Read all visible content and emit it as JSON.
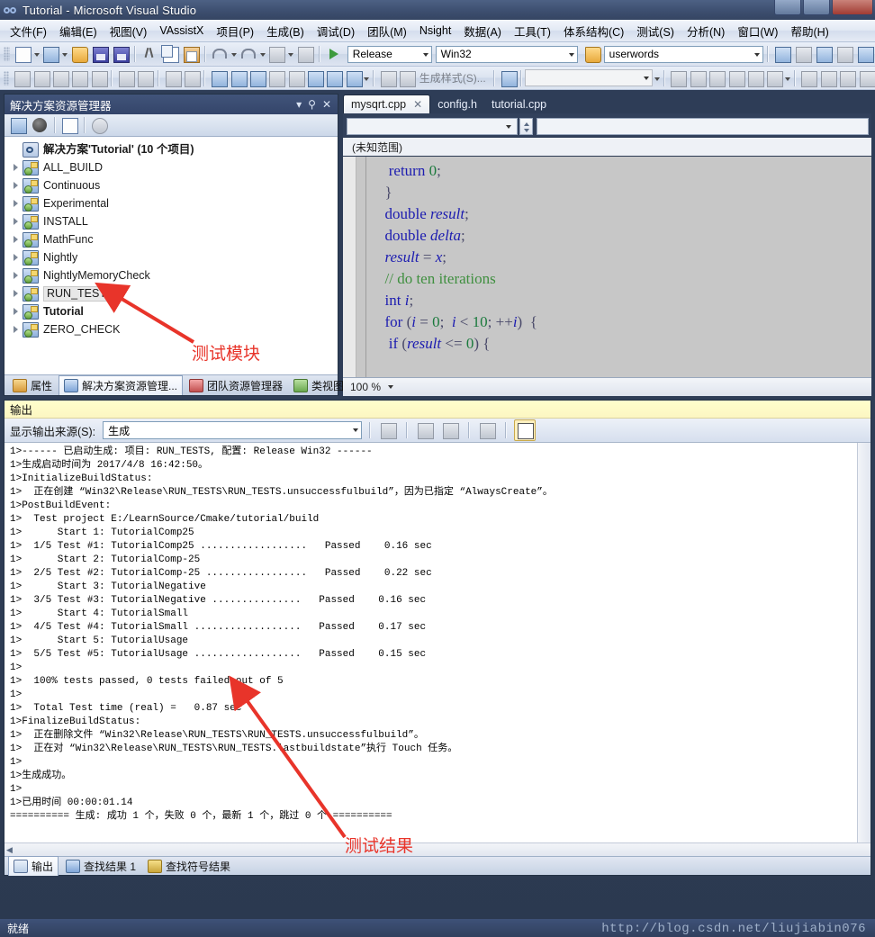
{
  "window": {
    "title": "Tutorial - Microsoft Visual Studio",
    "logo_icon": "visual-studio-logo-icon",
    "minimize_label": "",
    "maximize_label": "",
    "close_label": ""
  },
  "menubar": {
    "items": [
      {
        "label": "文件(F)"
      },
      {
        "label": "编辑(E)"
      },
      {
        "label": "视图(V)"
      },
      {
        "label": "VAssistX"
      },
      {
        "label": "项目(P)"
      },
      {
        "label": "生成(B)"
      },
      {
        "label": "调试(D)"
      },
      {
        "label": "团队(M)"
      },
      {
        "label": "Nsight"
      },
      {
        "label": "数据(A)"
      },
      {
        "label": "工具(T)"
      },
      {
        "label": "体系结构(C)"
      },
      {
        "label": "测试(S)"
      },
      {
        "label": "分析(N)"
      },
      {
        "label": "窗口(W)"
      },
      {
        "label": "帮助(H)"
      }
    ]
  },
  "toolbar": {
    "config_combo": "Release",
    "platform_combo": "Win32",
    "search_combo": "userwords",
    "build_style_label": "生成样式(S)...",
    "find_box_value": ""
  },
  "solution_explorer": {
    "title": "解决方案资源管理器",
    "root": "解决方案'Tutorial' (10 个项目)",
    "nodes": [
      {
        "label": "ALL_BUILD"
      },
      {
        "label": "Continuous"
      },
      {
        "label": "Experimental"
      },
      {
        "label": "INSTALL"
      },
      {
        "label": "MathFunc"
      },
      {
        "label": "Nightly"
      },
      {
        "label": "NightlyMemoryCheck"
      },
      {
        "label": "RUN_TESTS"
      },
      {
        "label": "Tutorial"
      },
      {
        "label": "ZERO_CHECK"
      }
    ],
    "bottom_tabs": [
      {
        "label": "属性"
      },
      {
        "label": "解决方案资源管理..."
      },
      {
        "label": "团队资源管理器"
      },
      {
        "label": "类视图"
      }
    ]
  },
  "editor": {
    "tabs": [
      {
        "label": "mysqrt.cpp",
        "active": true,
        "close": "✕"
      },
      {
        "label": "config.h",
        "active": false
      },
      {
        "label": "tutorial.cpp",
        "active": false
      }
    ],
    "scope_label": "(未知范围)",
    "type_combo": "",
    "member_combo": "",
    "zoom_level": "100 %",
    "code_lines": [
      "        return 0;",
      "    }",
      "    double result;",
      "    double delta;",
      "    result = x;",
      "    // do ten iterations",
      "    int i;",
      "    for (i = 0; i < 10; ++i) {",
      "      if (result <= 0) {"
    ]
  },
  "output": {
    "title": "输出",
    "source_label": "显示输出来源(S):",
    "source_value": "生成",
    "lines": [
      "1>------ 已启动生成: 项目: RUN_TESTS, 配置: Release Win32 ------",
      "1>生成启动时间为 2017/4/8 16:42:50。",
      "1>InitializeBuildStatus:",
      "1>  正在创建 “Win32\\Release\\RUN_TESTS\\RUN_TESTS.unsuccessfulbuild”，因为已指定 “AlwaysCreate”。",
      "1>PostBuildEvent:",
      "1>  Test project E:/LearnSource/Cmake/tutorial/build",
      "1>      Start 1: TutorialComp25",
      "1>  1/5 Test #1: TutorialComp25 ..................   Passed    0.16 sec",
      "1>      Start 2: TutorialComp-25",
      "1>  2/5 Test #2: TutorialComp-25 .................   Passed    0.22 sec",
      "1>      Start 3: TutorialNegative",
      "1>  3/5 Test #3: TutorialNegative ...............   Passed    0.16 sec",
      "1>      Start 4: TutorialSmall",
      "1>  4/5 Test #4: TutorialSmall ..................   Passed    0.17 sec",
      "1>      Start 5: TutorialUsage",
      "1>  5/5 Test #5: TutorialUsage ..................   Passed    0.15 sec",
      "1>",
      "1>  100% tests passed, 0 tests failed out of 5",
      "1>",
      "1>  Total Test time (real) =   0.87 sec",
      "1>FinalizeBuildStatus:",
      "1>  正在删除文件 “Win32\\Release\\RUN_TESTS\\RUN_TESTS.unsuccessfulbuild”。",
      "1>  正在对 “Win32\\Release\\RUN_TESTS\\RUN_TESTS.lastbuildstate”执行 Touch 任务。",
      "1>",
      "1>生成成功。",
      "1>",
      "1>已用时间 00:00:01.14",
      "========== 生成: 成功 1 个，失败 0 个，最新 1 个，跳过 0 个 =========="
    ],
    "bottom_tabs": [
      {
        "label": "输出",
        "active": true
      },
      {
        "label": "查找结果 1",
        "active": false
      },
      {
        "label": "查找符号结果",
        "active": false
      }
    ]
  },
  "statusbar": {
    "text": "就绪",
    "watermark": "http://blog.csdn.net/liujiabin076"
  },
  "annotations": [
    {
      "text": "测试模块"
    },
    {
      "text": "测试结果"
    }
  ],
  "colors": {
    "accent": "#e8342a",
    "chrome": "#31405d",
    "output_header": "#ffffcc"
  }
}
